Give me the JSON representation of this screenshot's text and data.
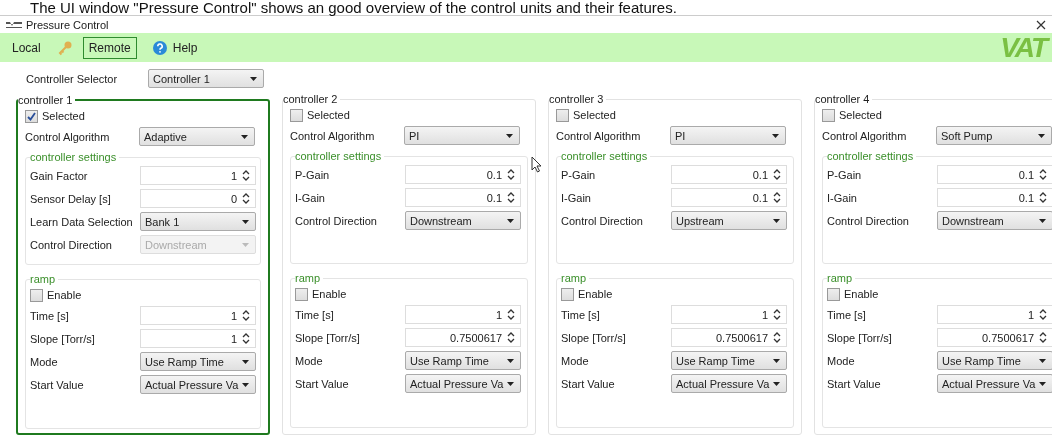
{
  "caption": "The UI window \"Pressure Control\" shows an good overview of the control units and their features.",
  "window": {
    "title": "Pressure Control"
  },
  "toolbar": {
    "items": [
      {
        "kind": "text",
        "label": "Local",
        "selected": false
      },
      {
        "kind": "key",
        "selected": false
      },
      {
        "kind": "text",
        "label": "Remote",
        "selected": true
      },
      {
        "kind": "help",
        "label": "Help",
        "selected": false
      }
    ],
    "logo": "VAT"
  },
  "selector": {
    "label": "Controller Selector",
    "value": "Controller 1"
  },
  "controllers": [
    {
      "title": "controller 1",
      "selected": true,
      "selected_label": "Selected",
      "algorithm_label": "Control Algorithm",
      "algorithm": "Adaptive",
      "settings": {
        "title": "controller settings",
        "rows": [
          {
            "kind": "spin",
            "label": "Gain Factor",
            "value": "1",
            "disabled": false
          },
          {
            "kind": "spin",
            "label": "Sensor Delay [s]",
            "value": "0",
            "disabled": false
          },
          {
            "kind": "combo",
            "label": "Learn Data Selection",
            "value": "Bank 1",
            "disabled": false
          },
          {
            "kind": "combo",
            "label": "Control Direction",
            "value": "Downstream",
            "disabled": true
          }
        ]
      },
      "ramp": {
        "title": "ramp",
        "enable_label": "Enable",
        "enabled": false,
        "rows": [
          {
            "kind": "spin",
            "label": "Time [s]",
            "value": "1",
            "disabled": false
          },
          {
            "kind": "spin",
            "label": "Slope [Torr/s]",
            "value": "1",
            "disabled": false
          },
          {
            "kind": "combo",
            "label": "Mode",
            "value": "Use Ramp Time",
            "disabled": false
          },
          {
            "kind": "combo",
            "label": "Start Value",
            "value": "Actual Pressure Va",
            "disabled": false
          }
        ]
      }
    },
    {
      "title": "controller 2",
      "selected": false,
      "selected_label": "Selected",
      "algorithm_label": "Control Algorithm",
      "algorithm": "PI",
      "settings": {
        "title": "controller settings",
        "rows": [
          {
            "kind": "spin",
            "label": "P-Gain",
            "value": "0.1",
            "disabled": false
          },
          {
            "kind": "spin",
            "label": "I-Gain",
            "value": "0.1",
            "disabled": false
          },
          {
            "kind": "combo",
            "label": "Control Direction",
            "value": "Downstream",
            "disabled": false
          }
        ]
      },
      "ramp": {
        "title": "ramp",
        "enable_label": "Enable",
        "enabled": false,
        "rows": [
          {
            "kind": "spin",
            "label": "Time [s]",
            "value": "1",
            "disabled": false
          },
          {
            "kind": "spin",
            "label": "Slope [Torr/s]",
            "value": "0.7500617",
            "disabled": false
          },
          {
            "kind": "combo",
            "label": "Mode",
            "value": "Use Ramp Time",
            "disabled": false
          },
          {
            "kind": "combo",
            "label": "Start Value",
            "value": "Actual Pressure Va",
            "disabled": false
          }
        ]
      }
    },
    {
      "title": "controller 3",
      "selected": false,
      "selected_label": "Selected",
      "algorithm_label": "Control Algorithm",
      "algorithm": "PI",
      "settings": {
        "title": "controller settings",
        "rows": [
          {
            "kind": "spin",
            "label": "P-Gain",
            "value": "0.1",
            "disabled": false
          },
          {
            "kind": "spin",
            "label": "I-Gain",
            "value": "0.1",
            "disabled": false
          },
          {
            "kind": "combo",
            "label": "Control Direction",
            "value": "Upstream",
            "disabled": false
          }
        ]
      },
      "ramp": {
        "title": "ramp",
        "enable_label": "Enable",
        "enabled": false,
        "rows": [
          {
            "kind": "spin",
            "label": "Time [s]",
            "value": "1",
            "disabled": false
          },
          {
            "kind": "spin",
            "label": "Slope [Torr/s]",
            "value": "0.7500617",
            "disabled": false
          },
          {
            "kind": "combo",
            "label": "Mode",
            "value": "Use Ramp Time",
            "disabled": false
          },
          {
            "kind": "combo",
            "label": "Start Value",
            "value": "Actual Pressure Va",
            "disabled": false
          }
        ]
      }
    },
    {
      "title": "controller 4",
      "selected": false,
      "selected_label": "Selected",
      "algorithm_label": "Control Algorithm",
      "algorithm": "Soft Pump",
      "settings": {
        "title": "controller settings",
        "rows": [
          {
            "kind": "spin",
            "label": "P-Gain",
            "value": "0.1",
            "disabled": false
          },
          {
            "kind": "spin",
            "label": "I-Gain",
            "value": "0.1",
            "disabled": false
          },
          {
            "kind": "combo",
            "label": "Control Direction",
            "value": "Downstream",
            "disabled": false
          }
        ]
      },
      "ramp": {
        "title": "ramp",
        "enable_label": "Enable",
        "enabled": false,
        "rows": [
          {
            "kind": "spin",
            "label": "Time [s]",
            "value": "1",
            "disabled": false
          },
          {
            "kind": "spin",
            "label": "Slope [Torr/s]",
            "value": "0.7500617",
            "disabled": false
          },
          {
            "kind": "combo",
            "label": "Mode",
            "value": "Use Ramp Time",
            "disabled": false
          },
          {
            "kind": "combo",
            "label": "Start Value",
            "value": "Actual Pressure Va",
            "disabled": false
          }
        ]
      }
    }
  ]
}
